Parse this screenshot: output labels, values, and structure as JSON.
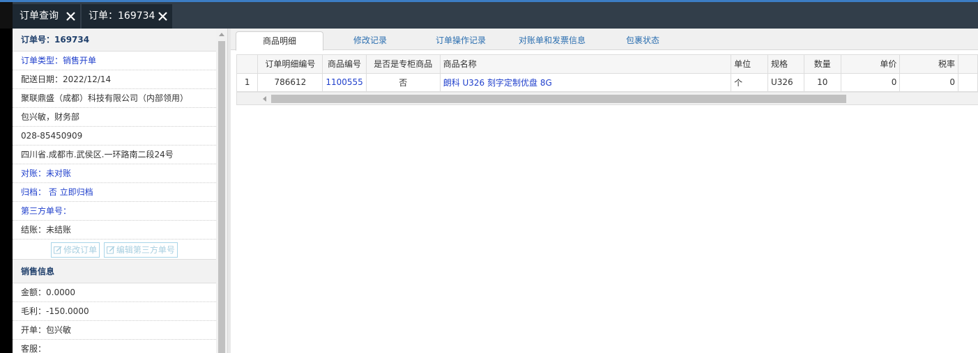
{
  "tabs": [
    {
      "label": "订单查询"
    },
    {
      "label": "订单：169734"
    }
  ],
  "left": {
    "order_no": "订单号：169734",
    "rows": [
      {
        "text": "订单类型：销售开单"
      },
      {
        "text": "配送日期：2022/12/14"
      },
      {
        "text": "聚联鼎盛（成都）科技有限公司（内部领用）"
      },
      {
        "text": "包兴敏，财务部"
      },
      {
        "text": "028-85450909"
      },
      {
        "text": "四川省.成都市.武侯区.一环路南二段24号"
      },
      {
        "text": "对账：未对账"
      },
      {
        "text": "归档：  否 立即归档"
      },
      {
        "text": "第三方单号："
      },
      {
        "text": "结账：未结账"
      }
    ],
    "buttons": {
      "modify": "修改订单",
      "edit_third": "编辑第三方单号"
    },
    "sales_title": "销售信息",
    "sales_rows": [
      {
        "text": "金额：0.0000"
      },
      {
        "text": "毛利：-150.0000"
      },
      {
        "text": "开单：包兴敏"
      },
      {
        "text": "客服："
      }
    ]
  },
  "subtabs": [
    {
      "label": "商品明细"
    },
    {
      "label": "修改记录"
    },
    {
      "label": "订单操作记录"
    },
    {
      "label": "对账单和发票信息"
    },
    {
      "label": "包裹状态"
    }
  ],
  "table": {
    "headers": [
      "",
      "订单明细编号",
      "商品编号",
      "是否是专柜商品",
      "商品名称",
      "单位",
      "规格",
      "数量",
      "单价",
      "税率"
    ],
    "rows": [
      [
        "1",
        "786612",
        "1100555",
        "否",
        "朗科 U326 刻字定制优盘 8G",
        "个",
        "U326",
        "10",
        "0",
        "0"
      ]
    ]
  },
  "colors": {
    "accent": "#3c7dc4",
    "tabbar": "#323e4a",
    "link": "#1f3fcc"
  }
}
